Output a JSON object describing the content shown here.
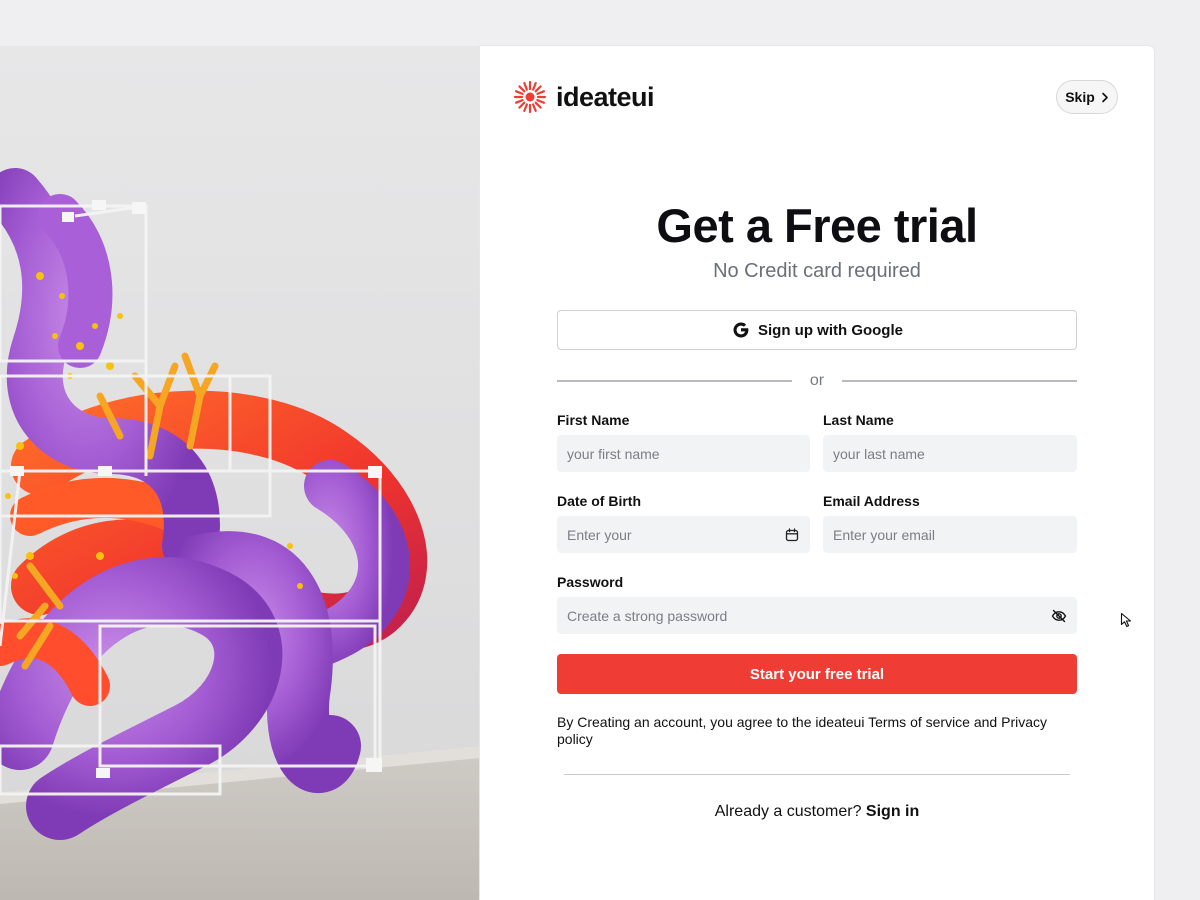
{
  "brand": {
    "name": "ideateui",
    "accent": "#ef3d35"
  },
  "header": {
    "skip_label": "Skip"
  },
  "hero": {
    "title": "Get a Free trial",
    "subtitle": "No Credit card required"
  },
  "google_button": {
    "label": "Sign up with Google",
    "icon": "google-icon"
  },
  "divider_text": "or",
  "form": {
    "first_name": {
      "label": "First Name",
      "placeholder": "your first name",
      "value": ""
    },
    "last_name": {
      "label": "Last Name",
      "placeholder": "your last name",
      "value": ""
    },
    "dob": {
      "label": "Date of Birth",
      "placeholder": "Enter your",
      "value": "",
      "icon": "calendar-icon"
    },
    "email": {
      "label": "Email Address",
      "placeholder": "Enter your email",
      "value": ""
    },
    "password": {
      "label": "Password",
      "placeholder": "Create a strong password",
      "value": "",
      "icon": "eye-off-icon"
    }
  },
  "submit": {
    "label": "Start your free trial"
  },
  "terms": {
    "text": "By Creating an account, you agree to the ideateui Terms of service and Privacy policy"
  },
  "footer": {
    "prompt": "Already a customer?",
    "signin_label": "Sign in"
  },
  "colors": {
    "page_background": "#efeff1",
    "field_background": "#f2f3f5",
    "primary_button": "#ef3d35"
  }
}
